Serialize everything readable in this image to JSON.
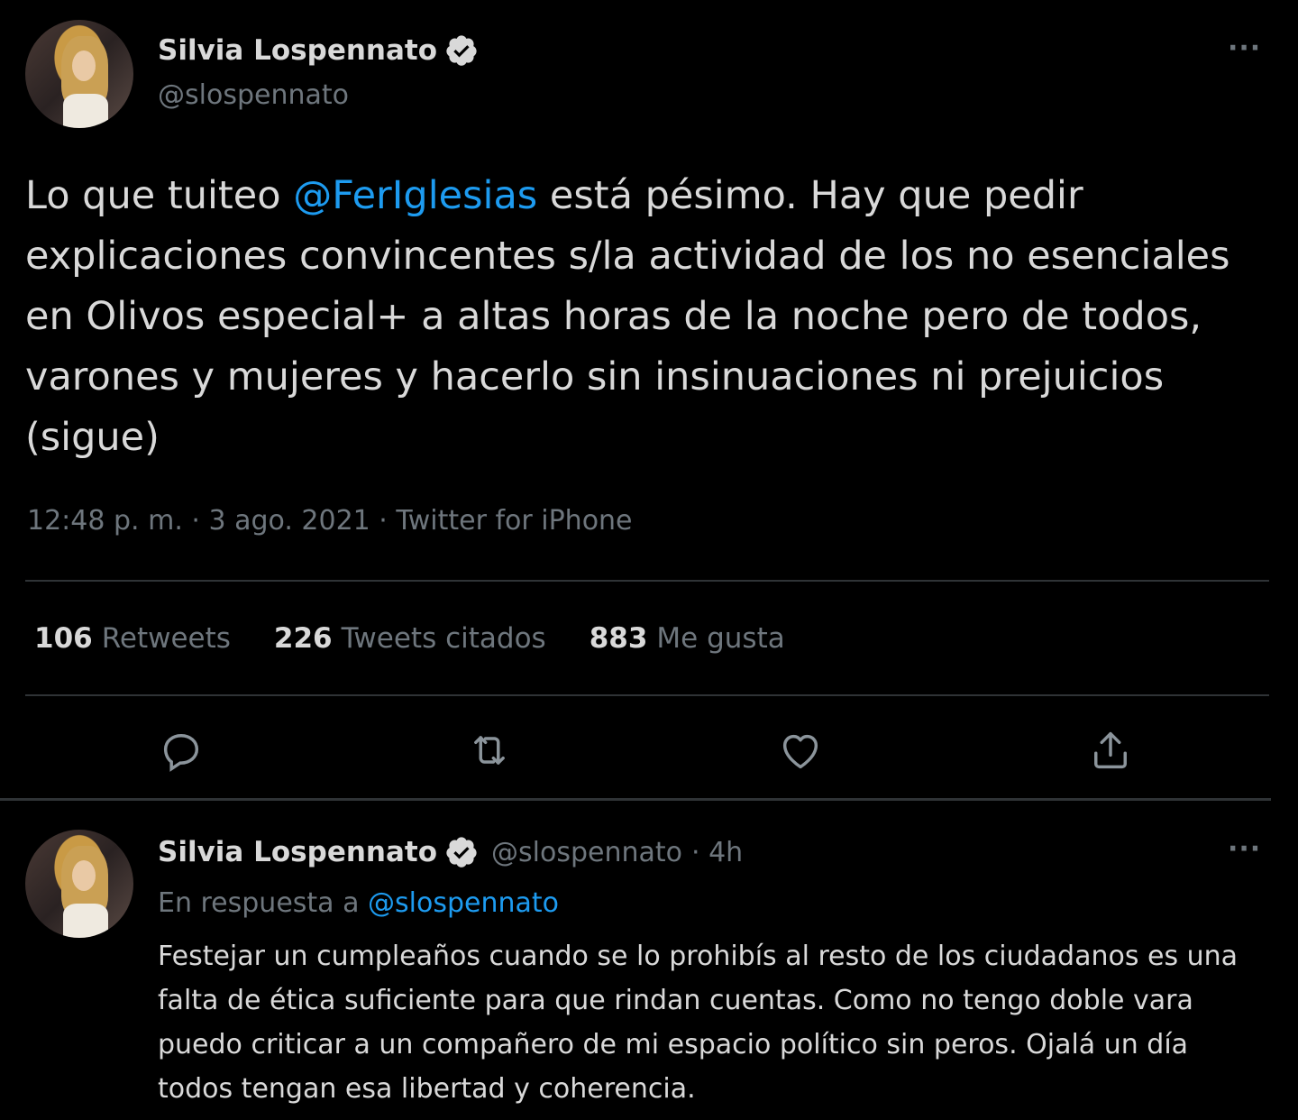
{
  "main_tweet": {
    "author": {
      "name": "Silvia Lospennato",
      "handle": "@slospennato",
      "verified": true
    },
    "text_before": "Lo que tuiteo ",
    "mention": "@FerIglesias",
    "text_after": " está pésimo. Hay que pedir explicaciones convincentes s/la actividad de los no esenciales en Olivos especial+ a altas horas de la noche pero de todos, varones y mujeres y hacerlo sin insinuaciones ni prejuicios (sigue)",
    "meta": "12:48 p. m. · 3 ago. 2021 · Twitter for iPhone",
    "stats": {
      "retweets_count": "106",
      "retweets_label": "Retweets",
      "quotes_count": "226",
      "quotes_label": "Tweets citados",
      "likes_count": "883",
      "likes_label": "Me gusta"
    },
    "more_label": "···",
    "actions": [
      "reply-icon",
      "retweet-icon",
      "like-icon",
      "share-icon"
    ]
  },
  "reply_tweet": {
    "author": {
      "name": "Silvia Lospennato",
      "handle": "@slospennato",
      "verified": true
    },
    "time": "· 4h",
    "replying_prefix": "En respuesta a ",
    "replying_to": "@slospennato",
    "text": "Festejar un cumpleaños cuando se lo prohibís al resto de los ciudadanos es una falta de ética suficiente para que rindan cuentas. Como no tengo doble vara puedo criticar a un compañero de mi espacio político sin peros. Ojalá un día todos tengan esa libertad y coherencia.",
    "more_label": "···"
  },
  "colors": {
    "background": "#000000",
    "text": "#d9d9d9",
    "secondary": "#6e767d",
    "link": "#1d9bf0",
    "divider": "#2f3336"
  }
}
